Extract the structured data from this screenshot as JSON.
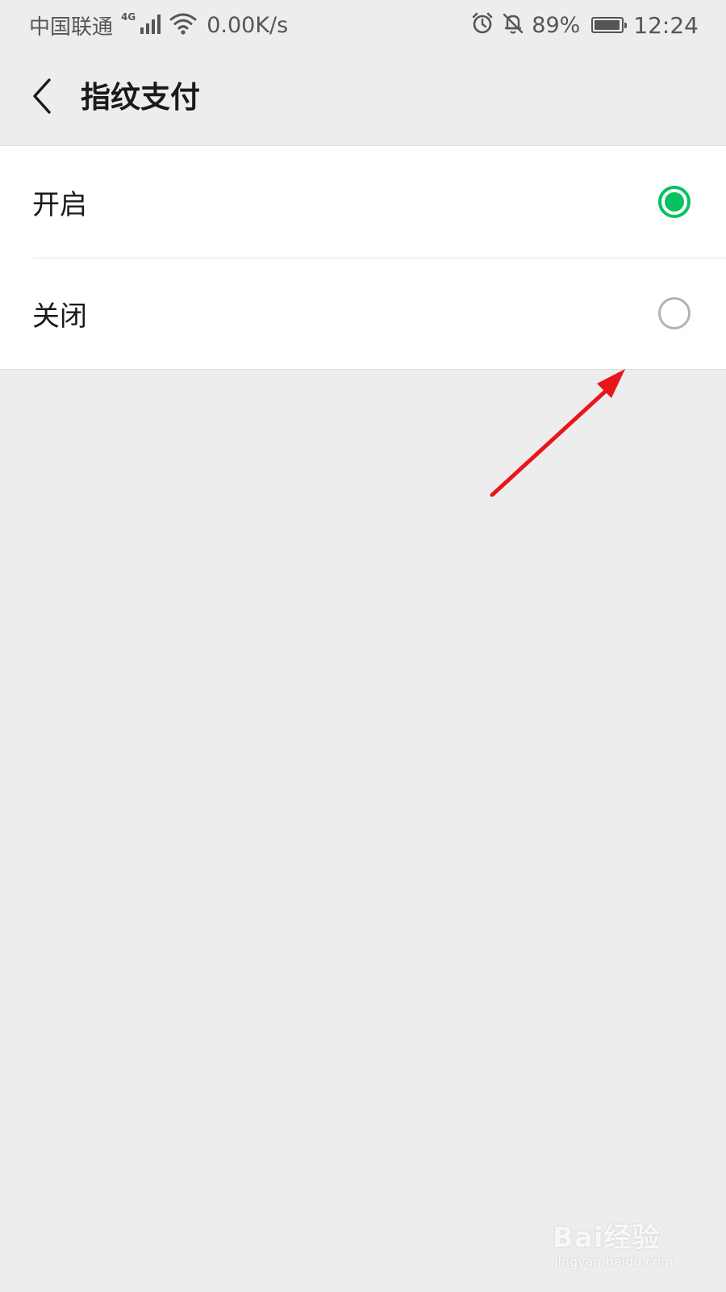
{
  "status_bar": {
    "carrier": "中国联通",
    "network_type": "4G",
    "speed": "0.00K/s",
    "battery_percent": "89%",
    "battery_level": 0.89,
    "time": "12:24",
    "icons": [
      "signal-icon",
      "wifi-icon",
      "alarm-icon",
      "mute-icon",
      "battery-icon"
    ]
  },
  "header": {
    "title": "指纹支付",
    "back_icon": "chevron-left-icon"
  },
  "options": [
    {
      "label": "开启",
      "selected": true
    },
    {
      "label": "关闭",
      "selected": false
    }
  ],
  "colors": {
    "accent": "#07c160",
    "background": "#ededed",
    "annotation_arrow": "#e8161b"
  },
  "watermark": {
    "logo": "Bai经验",
    "sub": "jingyan.baidu.com"
  }
}
